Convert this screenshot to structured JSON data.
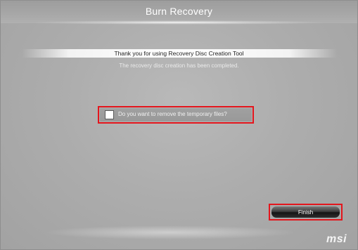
{
  "window": {
    "title": "Burn Recovery"
  },
  "message": {
    "thanks": "Thank you for using Recovery Disc Creation Tool",
    "completed": "The recovery disc creation has been completed."
  },
  "option": {
    "remove_temp_label": "Do you want to remove the temporary files?",
    "checked": false
  },
  "actions": {
    "finish_label": "Finish"
  },
  "brand": {
    "logo_text": "msi"
  },
  "colors": {
    "highlight": "#e4151c"
  }
}
